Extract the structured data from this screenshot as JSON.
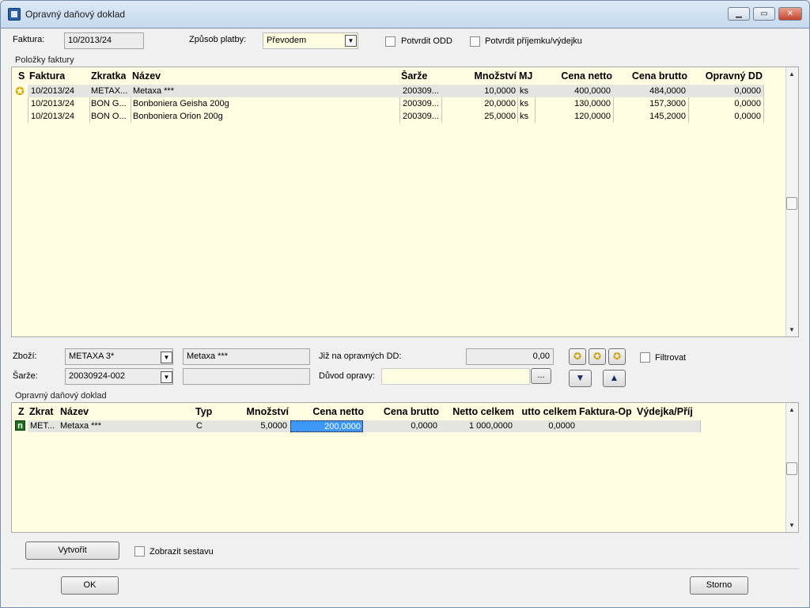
{
  "window": {
    "title": "Opravný daňový doklad"
  },
  "top": {
    "faktura_label": "Faktura:",
    "faktura_value": "10/2013/24",
    "zpusob_label": "Způsob platby:",
    "zpusob_value": "Převodem",
    "potvrdit_odd": "Potvrdit ODD",
    "potvrdit_prijemku": "Potvrdit příjemku/výdejku"
  },
  "items_grid": {
    "title": "Položky faktury",
    "headers": [
      "S",
      "Faktura",
      "Zkratka",
      "Název",
      "Šarže",
      "Množství",
      "MJ",
      "Cena netto",
      "Cena brutto",
      "Opravný DD"
    ],
    "rows": [
      [
        "",
        "10/2013/24",
        "METAX...",
        "Metaxa ***",
        "200309...",
        "10,0000",
        "ks",
        "400,0000",
        "484,0000",
        "0,0000"
      ],
      [
        "",
        "10/2013/24",
        "BON G...",
        "Bonboniera Geisha 200g",
        "200309...",
        "20,0000",
        "ks",
        "130,0000",
        "157,3000",
        "0,0000"
      ],
      [
        "",
        "10/2013/24",
        "BON O...",
        "Bonboniera Orion 200g",
        "200309...",
        "25,0000",
        "ks",
        "120,0000",
        "145,2000",
        "0,0000"
      ]
    ]
  },
  "mid": {
    "zbozi_label": "Zboží:",
    "zbozi_value": "METAXA 3*",
    "zbozi_name": "Metaxa ***",
    "sarze_label": "Šarže:",
    "sarze_value": "20030924-002",
    "sarze_extra": "",
    "jiz_label": "Již na opravných DD:",
    "jiz_value": "0,00",
    "duvod_label": "Důvod opravy:",
    "duvod_value": "",
    "ellipsis": "...",
    "filtrovat": "Filtrovat"
  },
  "odd_grid": {
    "title": "Opravný daňový doklad",
    "headers": [
      "Z",
      "Zkrat",
      "Název",
      "Typ",
      "Množství",
      "Cena netto",
      "Cena brutto",
      "Netto celkem",
      "utto celkem",
      "Faktura-Op",
      "Výdejka/Příj"
    ],
    "rows": [
      [
        "",
        "MET...",
        "Metaxa ***",
        "C",
        "5,0000",
        "200,0000",
        "0,0000",
        "1 000,0000",
        "0,0000",
        "",
        ""
      ]
    ]
  },
  "bottom": {
    "vytvorit": "Vytvořit",
    "zobrazit": "Zobrazit sestavu",
    "ok": "OK",
    "storno": "Storno"
  },
  "colors": {
    "grid_bg": "#fffde1",
    "selection": "#3d97f5",
    "title_gradient": "#c6d9ee"
  }
}
